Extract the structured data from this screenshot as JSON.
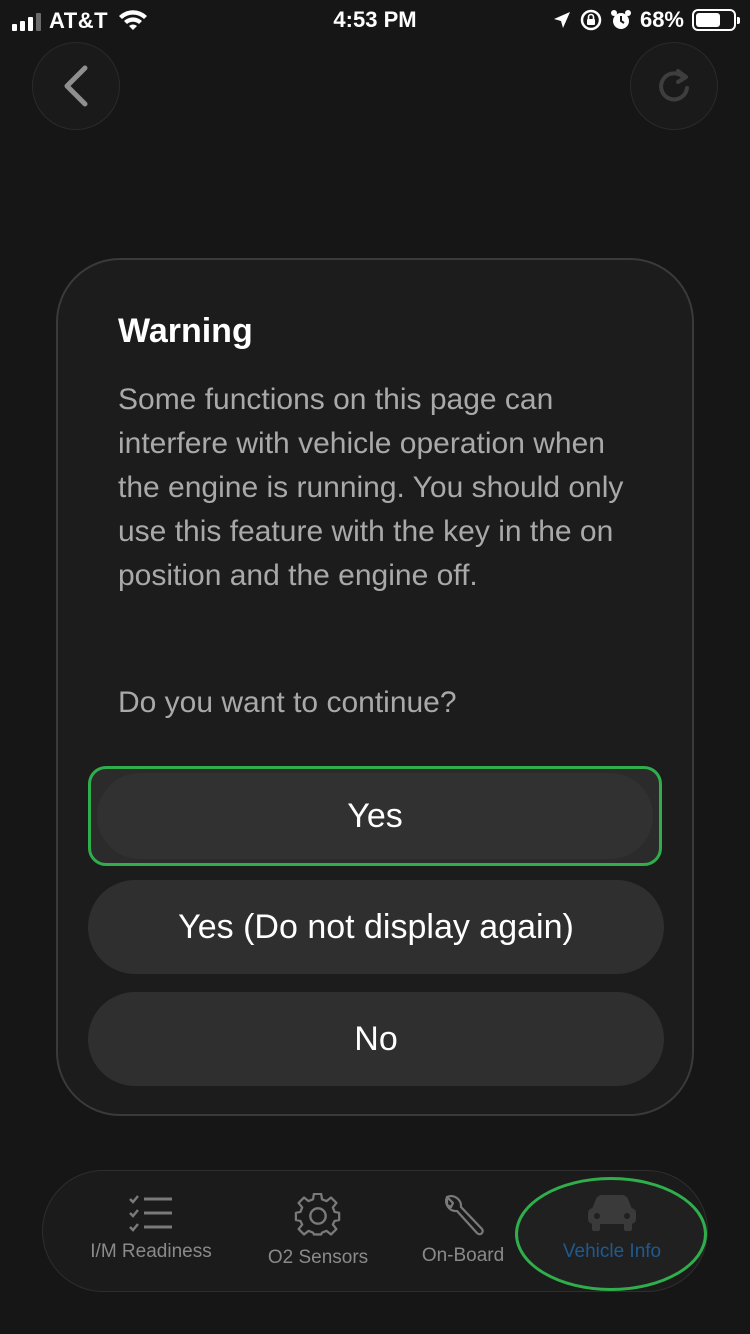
{
  "status_bar": {
    "carrier": "AT&T",
    "time": "4:53 PM",
    "battery_percent": "68%",
    "battery_level": 0.68,
    "icons": [
      "signal-icon",
      "wifi-icon",
      "location-icon",
      "orientation-lock-icon",
      "alarm-icon",
      "battery-icon"
    ]
  },
  "nav": {
    "back_icon": "chevron-left-icon",
    "refresh_icon": "refresh-icon"
  },
  "dialog": {
    "title": "Warning",
    "body": "Some functions on this page can interfere with vehicle operation when the engine is running. You should only use this feature with the key in the on position and the engine off.",
    "question": "Do you want to continue?",
    "buttons": {
      "yes": "Yes",
      "yes_no_repeat": "Yes (Do not display again)",
      "no": "No"
    },
    "highlight_color": "#2fae4b"
  },
  "tab_bar": {
    "tabs": [
      {
        "label": "I/M Readiness",
        "icon": "checklist-icon"
      },
      {
        "label": "O2 Sensors",
        "icon": "gear-icon"
      },
      {
        "label": "On-Board",
        "icon": "wrench-icon"
      },
      {
        "label": "Vehicle Info",
        "icon": "car-icon",
        "selected": true
      }
    ],
    "active_color": "#1f5a8f",
    "highlight_color": "#2fae4b"
  }
}
